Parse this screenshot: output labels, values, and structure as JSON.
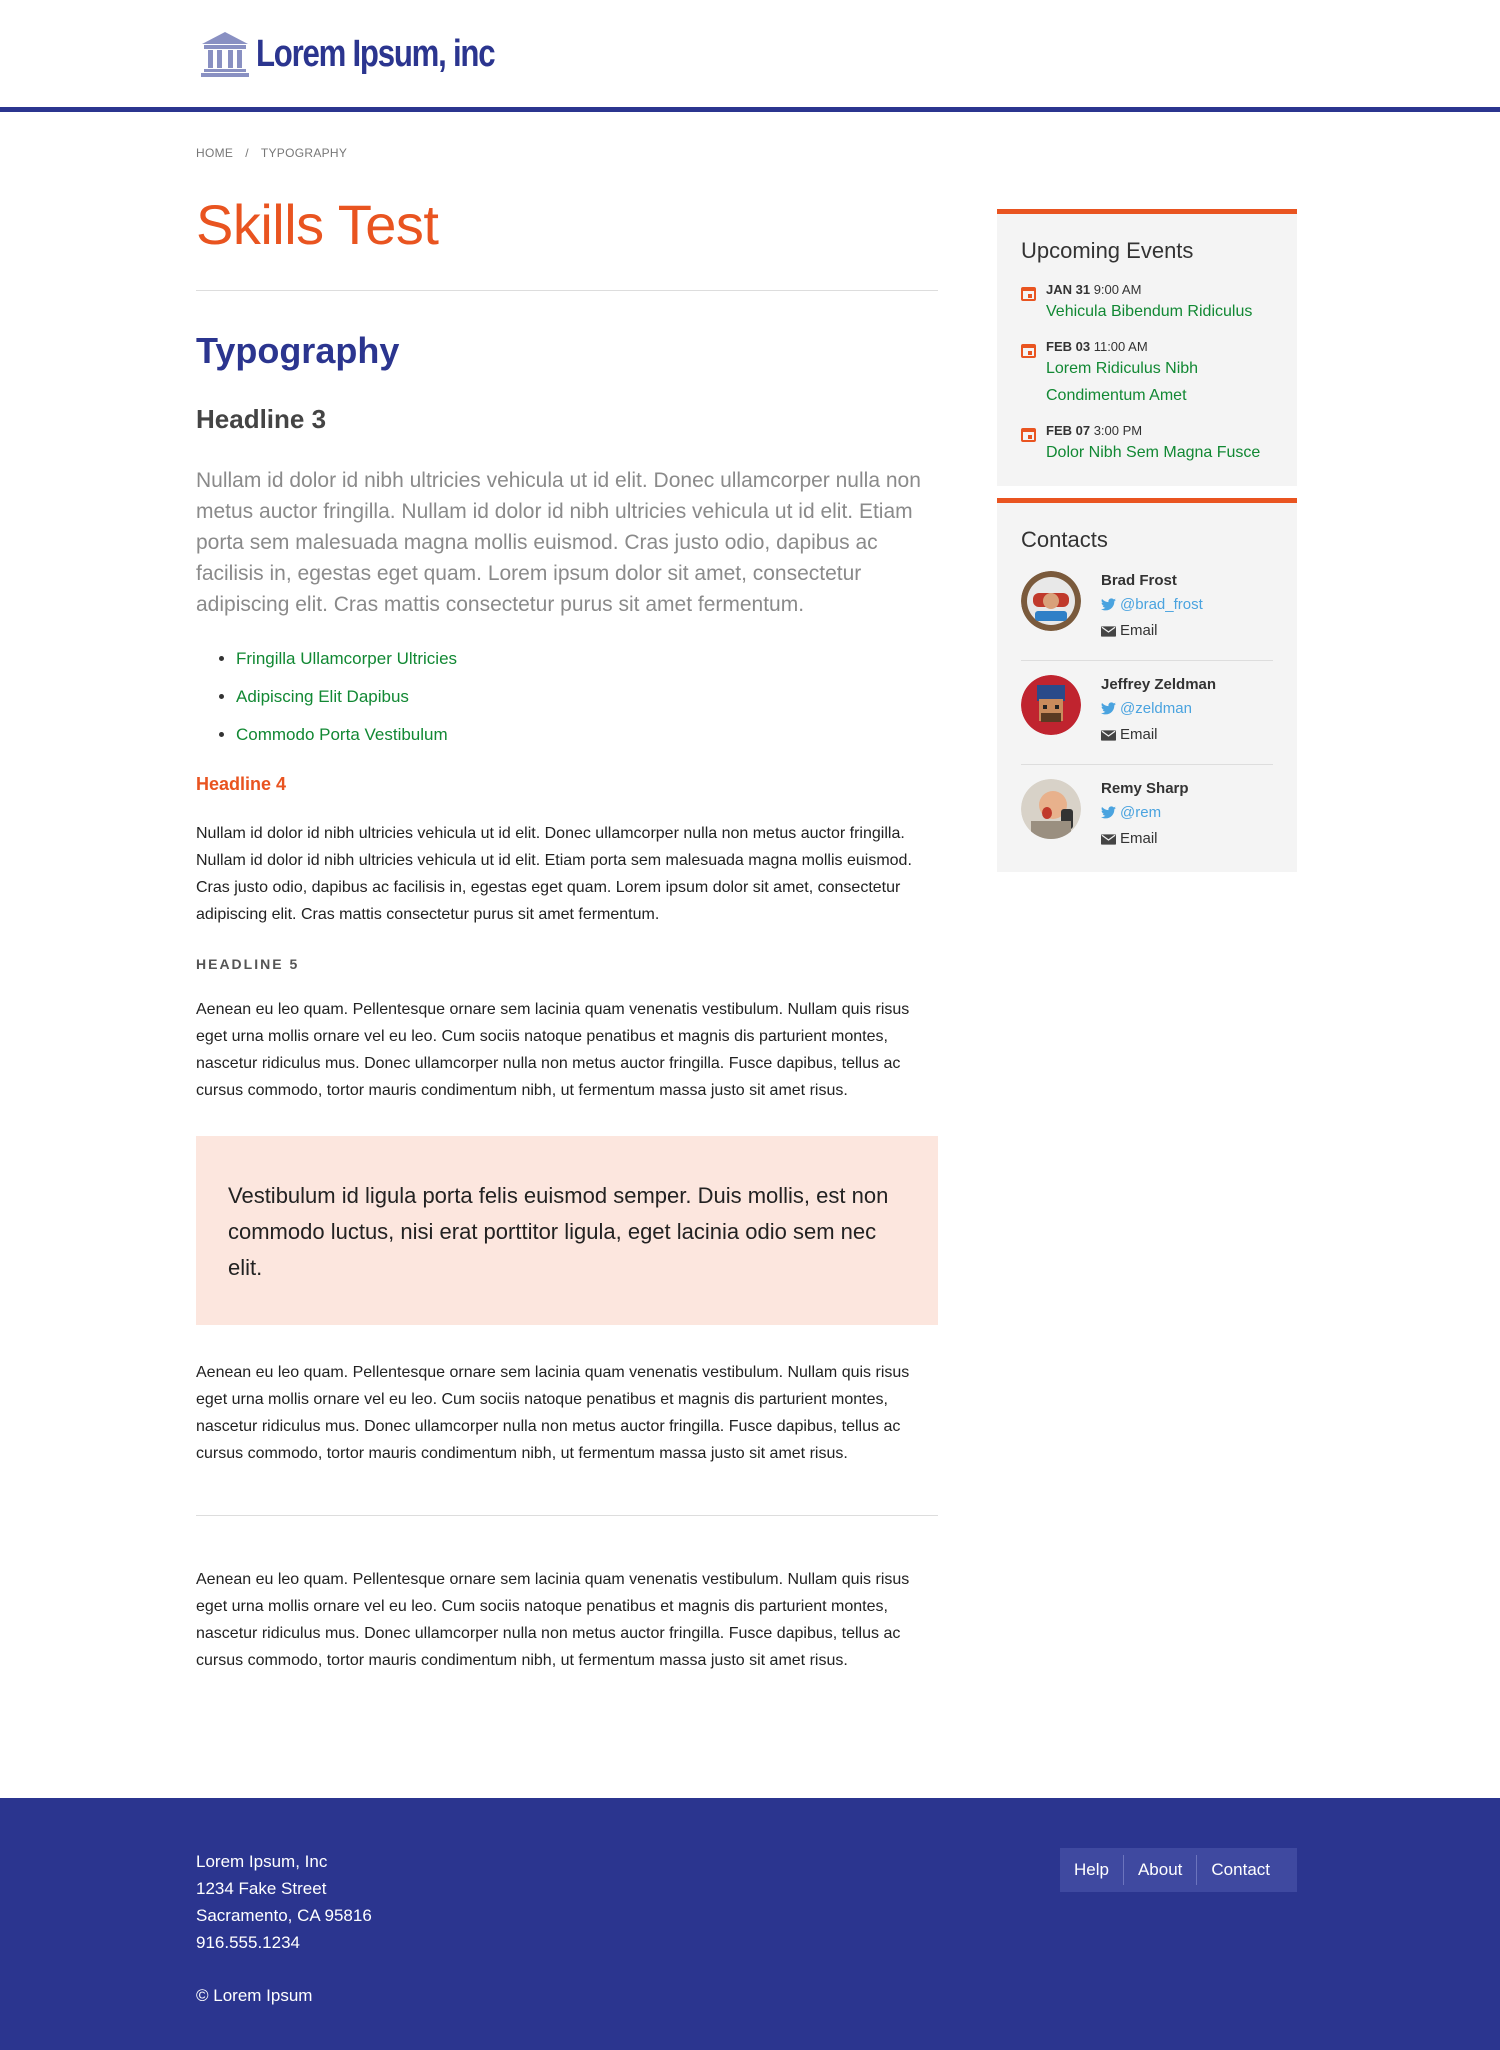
{
  "header": {
    "logo_text": "Lorem Ipsum, inc"
  },
  "breadcrumb": {
    "home": "HOME",
    "separator": "/",
    "current": "TYPOGRAPHY"
  },
  "main": {
    "title": "Skills Test",
    "h2": "Typography",
    "h3": "Headline 3",
    "lead": "Nullam id dolor id nibh ultricies vehicula ut id elit. Donec ullamcorper nulla non metus auctor fringilla. Nullam id dolor id nibh ultricies vehicula ut id elit. Etiam porta sem malesuada magna mollis euismod. Cras justo odio, dapibus ac facilisis in, egestas eget quam. Lorem ipsum dolor sit amet, consectetur adipiscing elit. Cras mattis consectetur purus sit amet fermentum.",
    "list": [
      "Fringilla Ullamcorper Ultricies",
      "Adipiscing Elit Dapibus",
      "Commodo Porta Vestibulum"
    ],
    "h4": "Headline 4",
    "p1": "Nullam id dolor id nibh ultricies vehicula ut id elit. Donec ullamcorper nulla non metus auctor fringilla. Nullam id dolor id nibh ultricies vehicula ut id elit. Etiam porta sem malesuada magna mollis euismod. Cras justo odio, dapibus ac facilisis in, egestas eget quam. Lorem ipsum dolor sit amet, consectetur adipiscing elit. Cras mattis consectetur purus sit amet fermentum.",
    "h5": "Headline 5",
    "p2": "Aenean eu leo quam. Pellentesque ornare sem lacinia quam venenatis vestibulum. Nullam quis risus eget urna mollis ornare vel eu leo. Cum sociis natoque penatibus et magnis dis parturient montes, nascetur ridiculus mus. Donec ullamcorper nulla non metus auctor fringilla. Fusce dapibus, tellus ac cursus commodo, tortor mauris condimentum nibh, ut fermentum massa justo sit amet risus.",
    "quote": "Vestibulum id ligula porta felis euismod semper. Duis mollis, est non commodo luctus, nisi erat porttitor ligula, eget lacinia odio sem nec elit.",
    "p3": "Aenean eu leo quam. Pellentesque ornare sem lacinia quam venenatis vestibulum. Nullam quis risus eget urna mollis ornare vel eu leo. Cum sociis natoque penatibus et magnis dis parturient montes, nascetur ridiculus mus. Donec ullamcorper nulla non metus auctor fringilla. Fusce dapibus, tellus ac cursus commodo, tortor mauris condimentum nibh, ut fermentum massa justo sit amet risus.",
    "p4": "Aenean eu leo quam. Pellentesque ornare sem lacinia quam venenatis vestibulum. Nullam quis risus eget urna mollis ornare vel eu leo. Cum sociis natoque penatibus et magnis dis parturient montes, nascetur ridiculus mus. Donec ullamcorper nulla non metus auctor fringilla. Fusce dapibus, tellus ac cursus commodo, tortor mauris condimentum nibh, ut fermentum massa justo sit amet risus."
  },
  "events": {
    "title": "Upcoming Events",
    "items": [
      {
        "date": "JAN 31",
        "time": "9:00 AM",
        "name": "Vehicula Bibendum Ridiculus"
      },
      {
        "date": "FEB 03",
        "time": "11:00 AM",
        "name": "Lorem Ridiculus Nibh Condimentum Amet"
      },
      {
        "date": "FEB 07",
        "time": "3:00 PM",
        "name": "Dolor Nibh Sem Magna Fusce"
      }
    ]
  },
  "contacts": {
    "title": "Contacts",
    "email_label": "Email",
    "items": [
      {
        "name": "Brad Frost",
        "handle": "@brad_frost"
      },
      {
        "name": "Jeffrey Zeldman",
        "handle": "@zeldman"
      },
      {
        "name": "Remy Sharp",
        "handle": "@rem"
      }
    ]
  },
  "footer": {
    "company": "Lorem Ipsum, Inc",
    "street": "1234 Fake Street",
    "city": "Sacramento, CA 95816",
    "phone": "916.555.1234",
    "copyright": "© Lorem Ipsum",
    "nav": [
      "Help",
      "About",
      "Contact"
    ]
  },
  "colors": {
    "brand_blue": "#2b358f",
    "accent_orange": "#e95420",
    "link_green": "#118833",
    "twitter_blue": "#4aa3df",
    "quote_bg": "#fce6de"
  },
  "icons": [
    "bank-logo-icon",
    "calendar-icon",
    "twitter-icon",
    "envelope-icon"
  ]
}
